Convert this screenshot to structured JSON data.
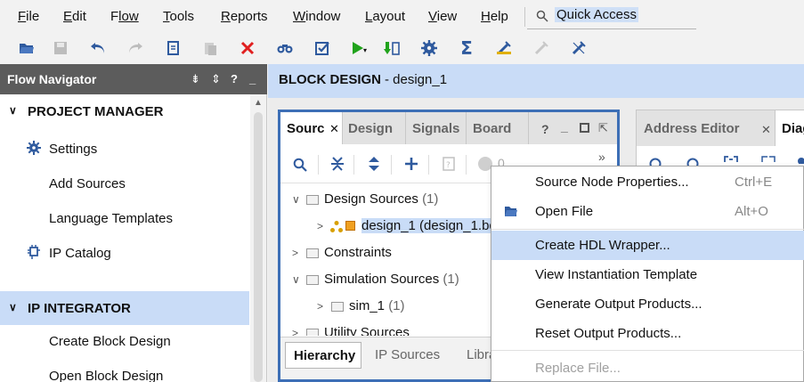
{
  "menu": {
    "items": [
      {
        "mn": "F",
        "rest": "ile"
      },
      {
        "mn": "E",
        "rest": "dit"
      },
      {
        "mn": "F",
        "rest": "low",
        "pre": ""
      },
      {
        "mn": "T",
        "rest": "ools"
      },
      {
        "mn": "R",
        "rest": "eports"
      },
      {
        "mn": "W",
        "rest": "indow"
      },
      {
        "mn": "L",
        "rest": "ayout"
      },
      {
        "mn": "V",
        "rest": "iew"
      },
      {
        "mn": "H",
        "rest": "elp"
      }
    ],
    "quick_access": "Quick Access"
  },
  "flow_navigator": {
    "title": "Flow Navigator",
    "sections": [
      {
        "label": "PROJECT MANAGER",
        "items": [
          "Settings",
          "Add Sources",
          "Language Templates",
          "IP Catalog"
        ]
      },
      {
        "label": "IP INTEGRATOR",
        "items": [
          "Create Block Design",
          "Open Block Design"
        ]
      }
    ]
  },
  "block_design": {
    "title": "BLOCK DESIGN",
    "subtitle": "- design_1"
  },
  "sources_panel": {
    "tabs": [
      "Sourc",
      "Design",
      "Signals",
      "Board"
    ],
    "count_value": "0",
    "tree": {
      "design_sources": {
        "label": "Design Sources",
        "count": "(1)"
      },
      "design_1": {
        "label": "design_1 (design_1.bd"
      },
      "constraints": {
        "label": "Constraints"
      },
      "simulation_sources": {
        "label": "Simulation Sources",
        "count": "(1)"
      },
      "sim_1": {
        "label": "sim_1",
        "count": "(1)"
      },
      "utility_sources": {
        "label": "Utility Sources"
      }
    },
    "bottom_tabs": [
      "Hierarchy",
      "IP Sources",
      "Libra"
    ]
  },
  "right_panel": {
    "tabs": [
      "Address Editor",
      "Diag"
    ]
  },
  "context_menu": {
    "items": [
      {
        "label": "Source Node Properties...",
        "shortcut": "Ctrl+E"
      },
      {
        "label": "Open File",
        "shortcut": "Alt+O"
      },
      {
        "label": "Create HDL Wrapper...",
        "shortcut": ""
      },
      {
        "label": "View Instantiation Template",
        "shortcut": ""
      },
      {
        "label": "Generate Output Products...",
        "shortcut": ""
      },
      {
        "label": "Reset Output Products...",
        "shortcut": ""
      },
      {
        "label": "Replace File...",
        "shortcut": ""
      }
    ],
    "highlighted": "Create HDL Wrapper..."
  },
  "colors": {
    "selection": "#c9dcf7",
    "active_panel_border": "#3d6fb6",
    "nav_header": "#5c5c5c",
    "run_green": "#21a31c",
    "delete_red": "#e02020",
    "icon_blue": "#2f5a9e"
  },
  "icons": [
    "open-project-icon",
    "save-icon",
    "undo-icon",
    "redo-icon",
    "copy-icon",
    "paste-icon",
    "delete-icon",
    "find-icon",
    "validate-icon",
    "run-icon",
    "program-icon",
    "settings-icon",
    "sigma-icon",
    "debug-icon",
    "autoconnect-icon",
    "edit-icon"
  ]
}
